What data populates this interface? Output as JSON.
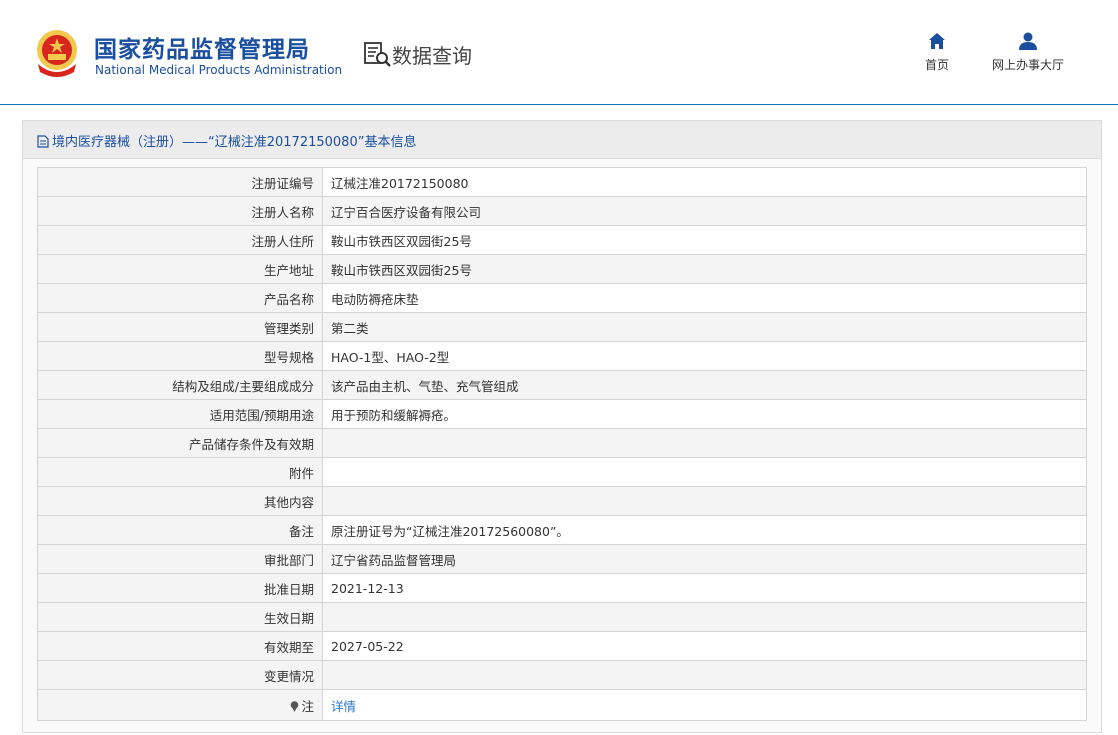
{
  "header": {
    "logo_cn": "国家药品监督管理局",
    "logo_en": "National Medical Products Administration",
    "section_title": "数据查询",
    "nav": [
      {
        "label": "首页",
        "icon": "home-icon"
      },
      {
        "label": "网上办事大厅",
        "icon": "user-icon"
      }
    ]
  },
  "panel": {
    "title": "境内医疗器械（注册）——“辽械注准20172150080”基本信息",
    "rows": [
      {
        "label": "注册证编号",
        "value": "辽械注准20172150080"
      },
      {
        "label": "注册人名称",
        "value": "辽宁百合医疗设备有限公司"
      },
      {
        "label": "注册人住所",
        "value": "鞍山市铁西区双园街25号"
      },
      {
        "label": "生产地址",
        "value": "鞍山市铁西区双园街25号"
      },
      {
        "label": "产品名称",
        "value": "电动防褥疮床垫"
      },
      {
        "label": "管理类别",
        "value": "第二类"
      },
      {
        "label": "型号规格",
        "value": "HAO-1型、HAO-2型"
      },
      {
        "label": "结构及组成/主要组成成分",
        "value": "该产品由主机、气垫、充气管组成"
      },
      {
        "label": "适用范围/预期用途",
        "value": "用于预防和缓解褥疮。"
      },
      {
        "label": "产品储存条件及有效期",
        "value": ""
      },
      {
        "label": "附件",
        "value": ""
      },
      {
        "label": "其他内容",
        "value": ""
      },
      {
        "label": "备注",
        "value": "原注册证号为“辽械注准20172560080”。"
      },
      {
        "label": "审批部门",
        "value": "辽宁省药品监督管理局"
      },
      {
        "label": "批准日期",
        "value": "2021-12-13"
      },
      {
        "label": "生效日期",
        "value": ""
      },
      {
        "label": "有效期至",
        "value": "2027-05-22"
      },
      {
        "label": "变更情况",
        "value": ""
      }
    ],
    "note_row": {
      "label": "注",
      "link": "详情",
      "icon": "pin-icon"
    }
  }
}
